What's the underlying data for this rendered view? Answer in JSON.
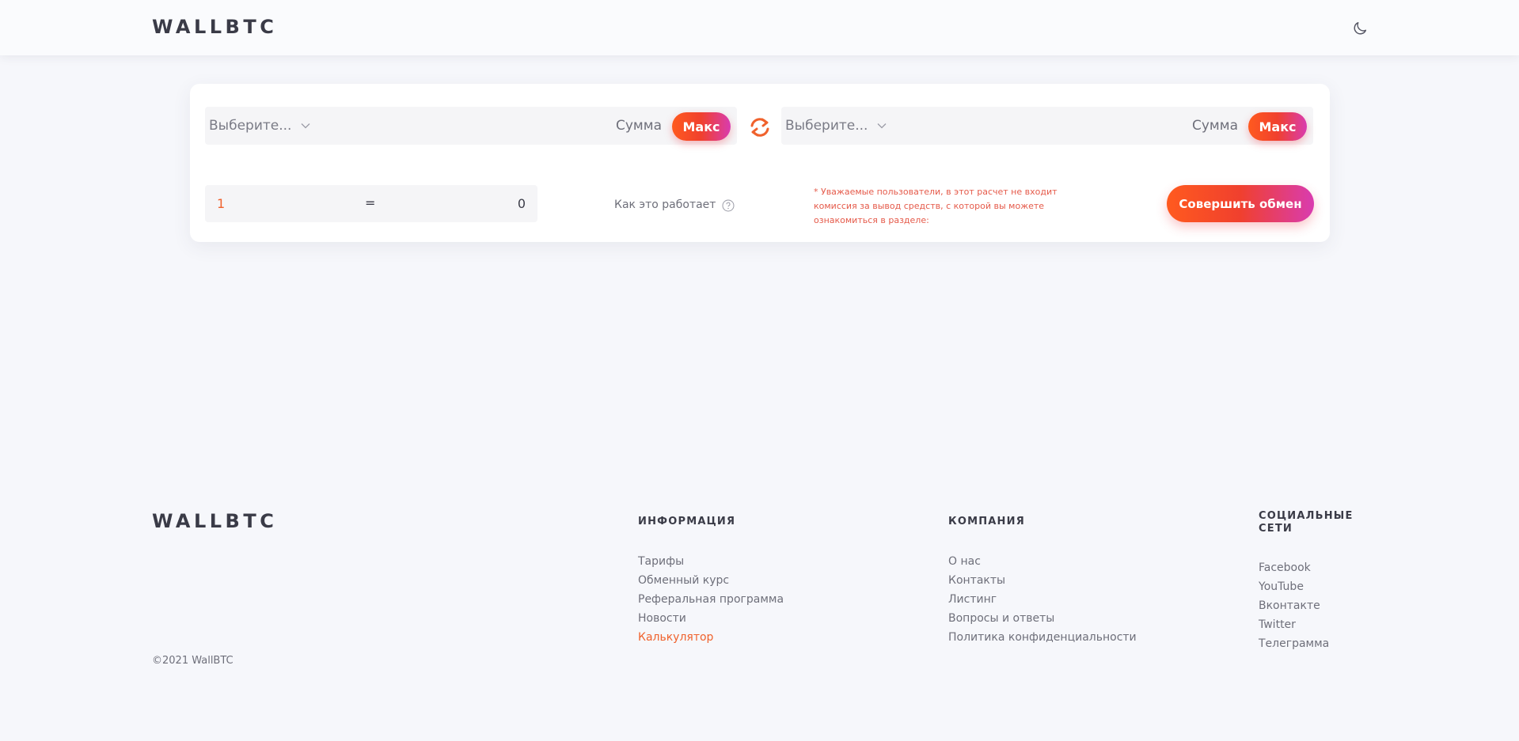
{
  "header": {
    "logo": "WALLBTC",
    "theme_toggle_icon": "moon-icon"
  },
  "exchange": {
    "from": {
      "select_label": "Выберите...",
      "sum_label": "Сумма",
      "max_label": "Макс"
    },
    "to": {
      "select_label": "Выберите...",
      "sum_label": "Сумма",
      "max_label": "Макс"
    },
    "swap_icon": "swap-icon",
    "rate": {
      "from_value": "1",
      "equals": "=",
      "to_value": "0"
    },
    "how_it_works": "Как это работает",
    "notice": "* Уважаемые пользователи, в этот расчет не входит комиссия за вывод средств, с которой вы можете ознакомиться в разделе:",
    "submit_label": "Совершить обмен",
    "accent_color": "#f0622d"
  },
  "footer": {
    "logo": "WALLBTC",
    "copyright": "©2021 WallBTC",
    "columns": [
      {
        "title": "ИНФОРМАЦИЯ",
        "links": [
          "Тарифы",
          "Обменный курс",
          "Реферальная программа",
          "Новости",
          "Калькулятор"
        ],
        "active_index": 4
      },
      {
        "title": "КОМПАНИЯ",
        "links": [
          "О нас",
          "Контакты",
          "Листинг",
          "Вопросы и ответы",
          "Политика конфиденциальности"
        ]
      },
      {
        "title_lines": [
          "СОЦИАЛЬНЫЕ",
          "СЕТИ"
        ],
        "links": [
          "Facebook",
          "YouTube",
          "Вконтакте",
          "Twitter",
          "Телеграмма"
        ]
      }
    ]
  }
}
